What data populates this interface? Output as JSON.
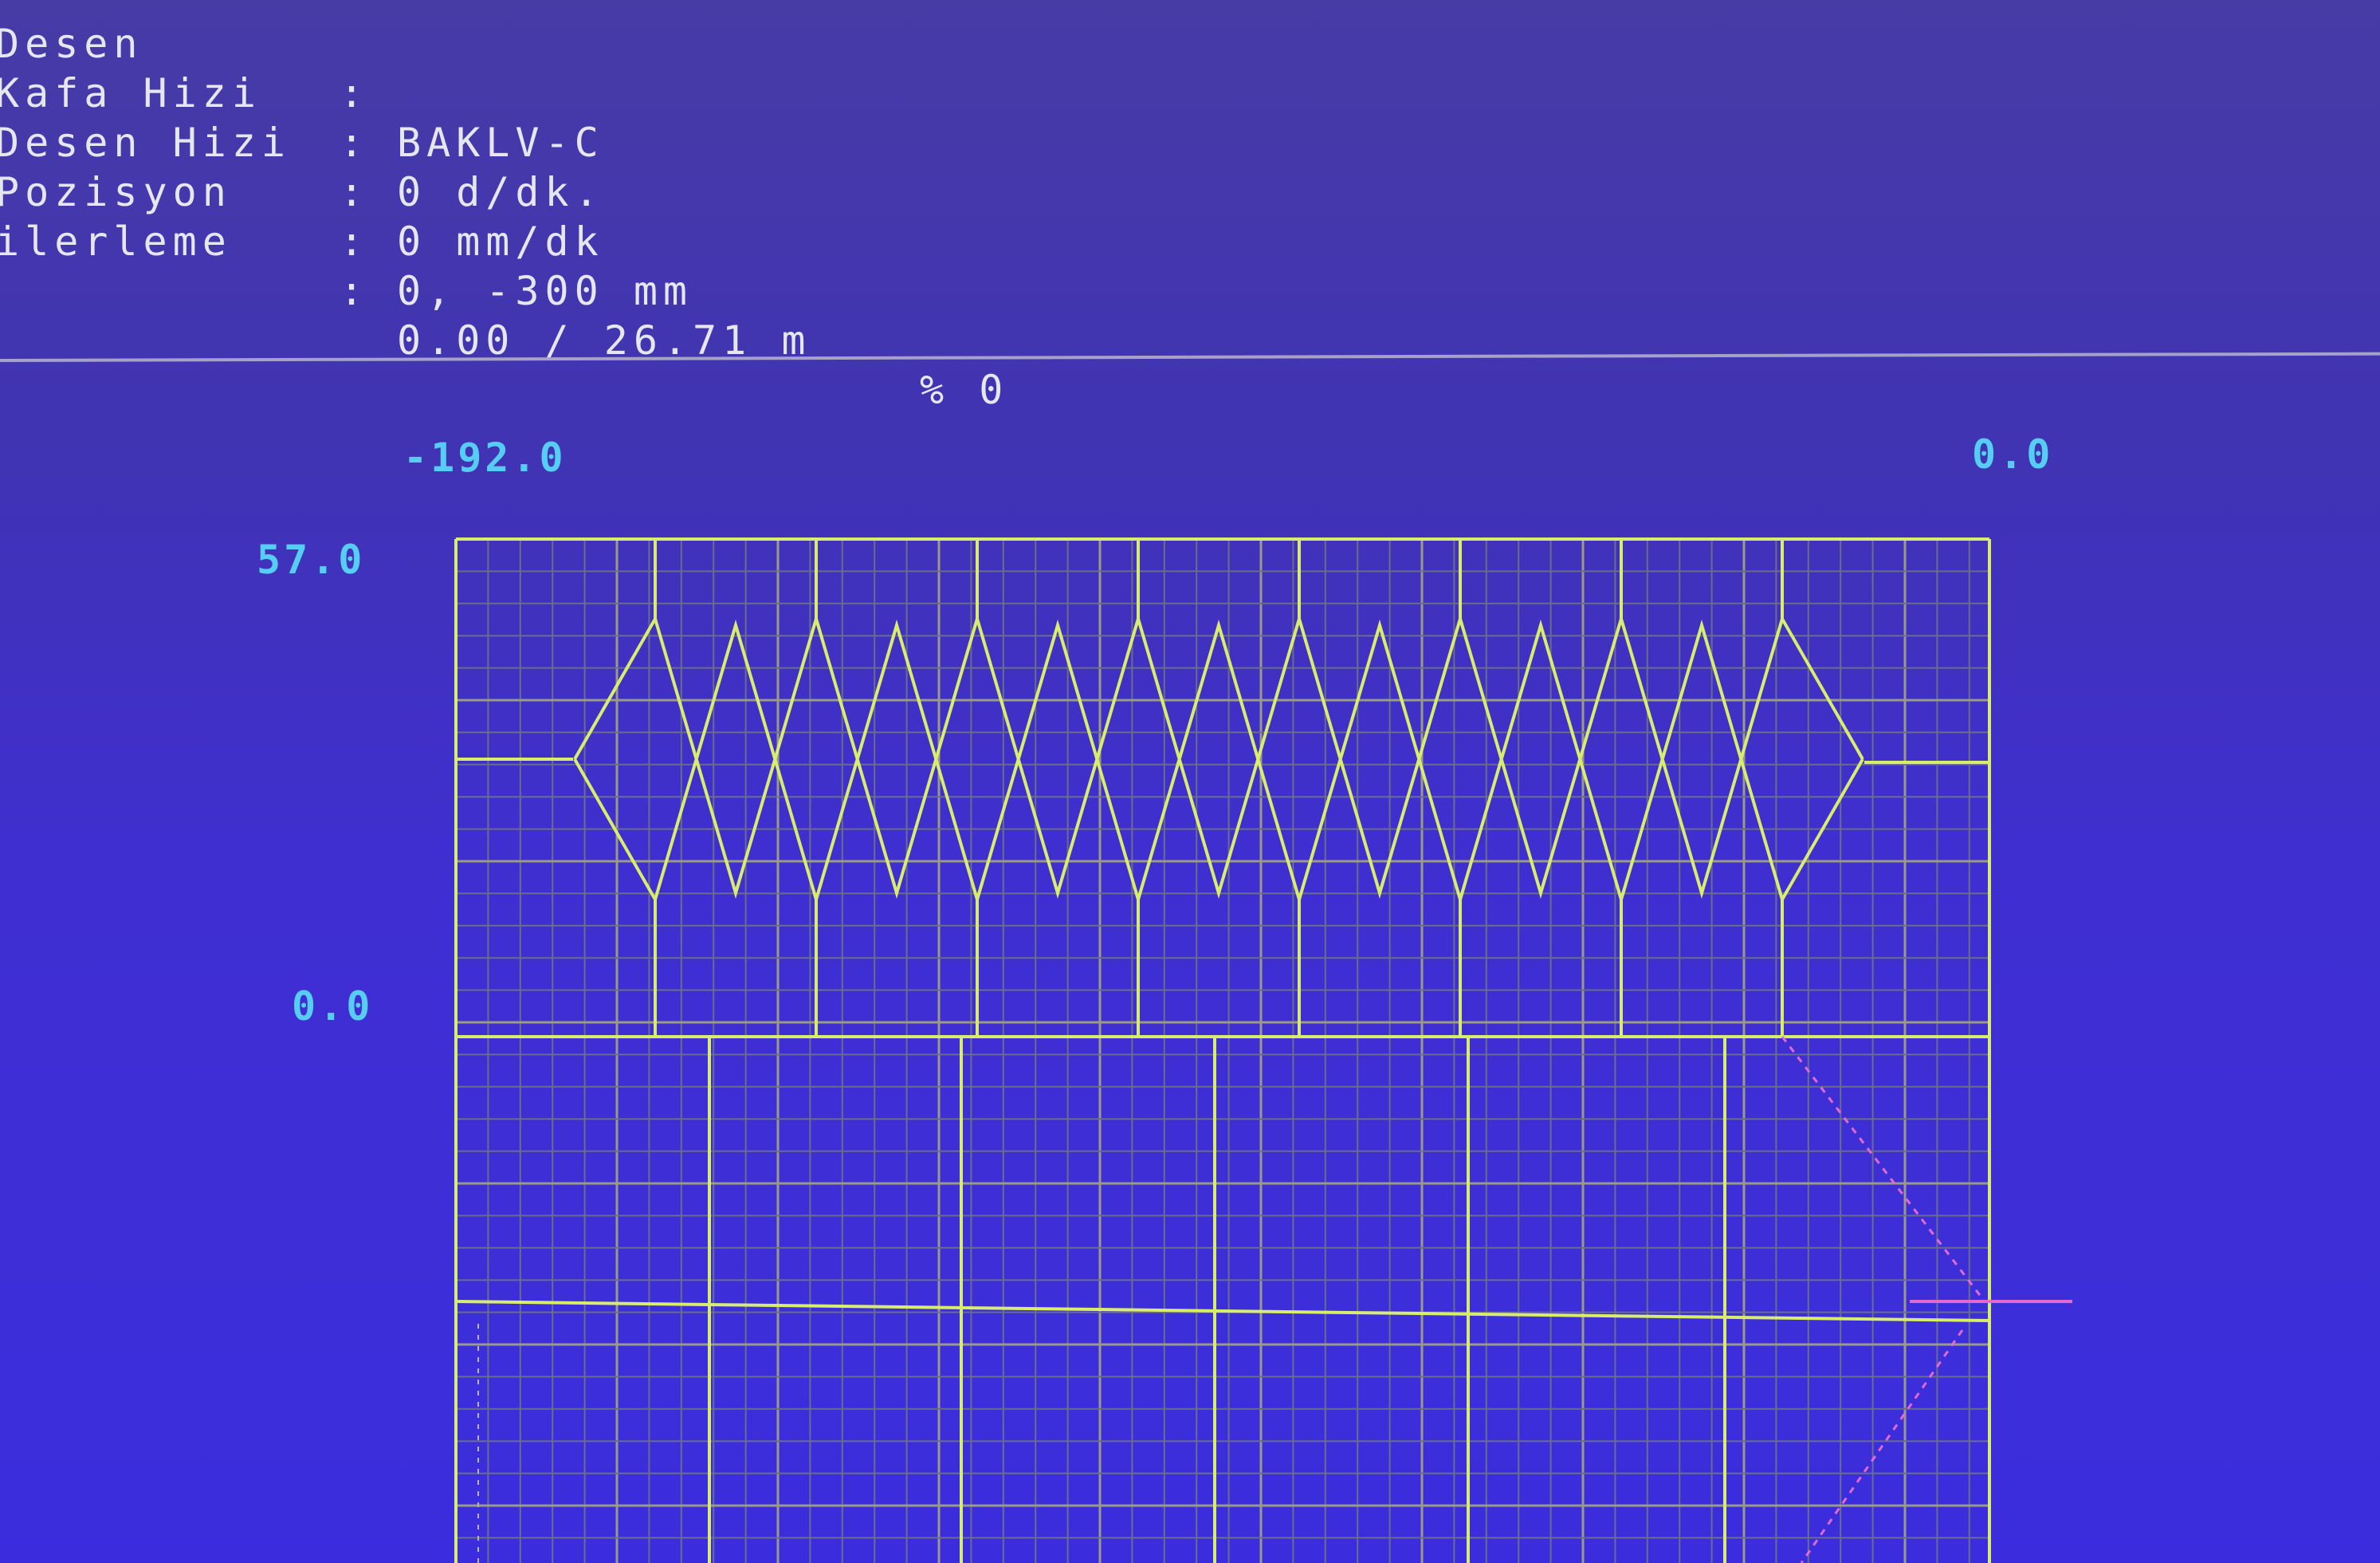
{
  "status_panel": {
    "rows": [
      {
        "label": "Desen",
        "value": "BAKLV-C",
        "extra": ""
      },
      {
        "label": "Kafa Hizi",
        "value": "0 d/dk.",
        "extra": ""
      },
      {
        "label": "Desen Hizi",
        "value": "0 mm/dk",
        "extra": ""
      },
      {
        "label": "Pozisyon",
        "value": "0, -300 mm",
        "extra": ""
      },
      {
        "label": "ilerleme",
        "value": "0.00 / 26.71 m",
        "extra": "% 0"
      }
    ],
    "separator": ":"
  },
  "pattern_view": {
    "x_min_label": "-192.0",
    "x_max_label": "0.0",
    "y_max_label": "57.0",
    "y_zero_label": "0.0",
    "diamond_count": 8,
    "colors": {
      "trace": "#d8ec6e",
      "grid_major": "#9a9a86",
      "grid_minor": "#6a6d8c",
      "axis_text": "#56cdf2",
      "marker_line": "#e06ad2",
      "background": "#3f2fd1"
    }
  }
}
